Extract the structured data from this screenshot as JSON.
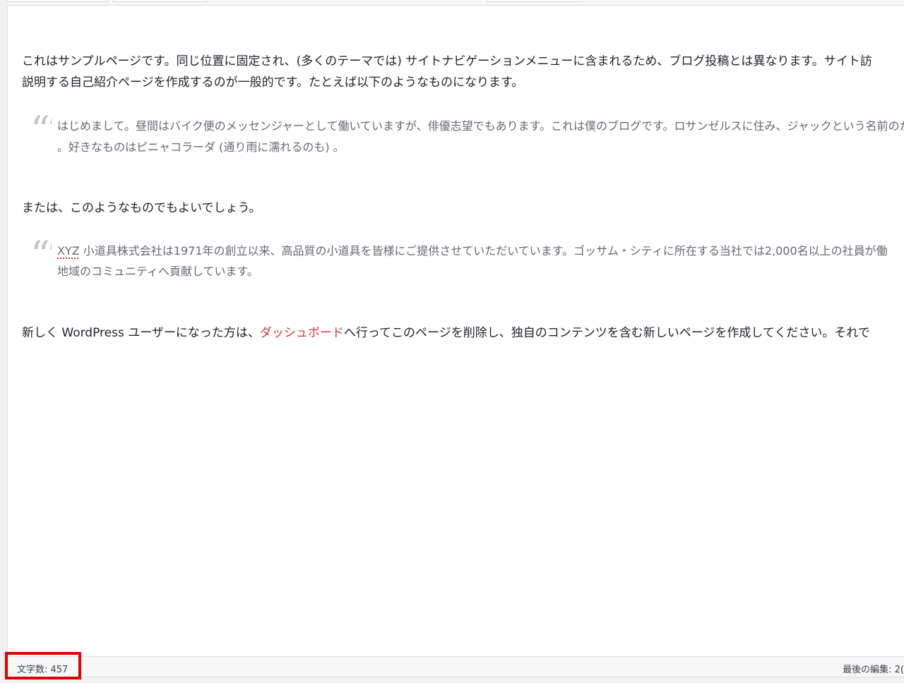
{
  "editor": {
    "paragraphs": [
      "これはサンプルページです。同じ位置に固定され、(多くのテーマでは) サイトナビゲーションメニューに含まれるため、ブログ投稿とは異なります。サイト訪",
      "説明する自己紹介ページを作成するのが一般的です。たとえば以下のようなものになります。",
      "または、このようなものでもよいでしょう。",
      "新しく WordPress ユーザーになった方は、",
      "へ行ってこのページを削除し、独自のコンテンツを含む新しいページを作成してください。それで"
    ],
    "quote1": [
      "はじめまして。昼間はバイク便のメッセンジャーとして働いていますが、俳優志望でもあります。これは僕のブログです。ロサンゼルスに住み、ジャックという名前のかわ",
      "。好きなものはピニャコラーダ (通り雨に濡れるのも) 。"
    ],
    "quote2_lead": "XYZ",
    "quote2": [
      " 小道具株式会社は1971年の創立以来、高品質の小道具を皆様にご提供させていただいています。ゴッサム・シティに所在する当社では2,000名以上の社員が働",
      "地域のコミュニティへ貢献しています。"
    ],
    "dashboard_link": "ダッシュボード",
    "quote_mark": "““"
  },
  "status_bar": {
    "word_count": "文字数: 457",
    "last_edit": "最後の編集: 2("
  },
  "colors": {
    "link": "#d63638",
    "highlight": "#e00000"
  }
}
